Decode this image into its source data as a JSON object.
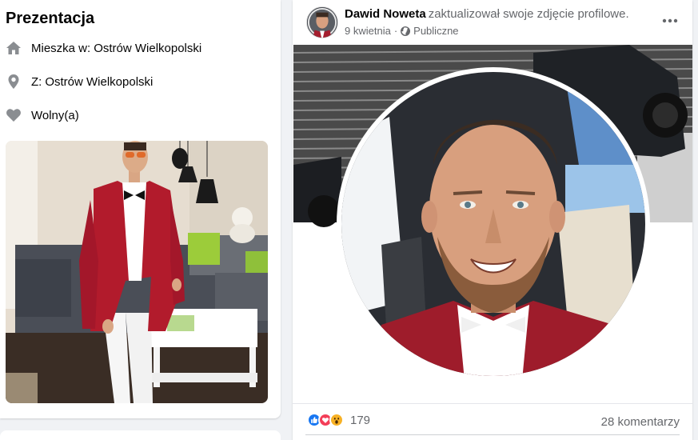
{
  "intro": {
    "title": "Prezentacja",
    "lives_label": "Mieszka w:",
    "lives_value": "Ostrów Wielkopolski",
    "from_label": "Z:",
    "from_value": "Ostrów Wielkopolski",
    "relationship": "Wolny(a)",
    "icons": {
      "lives": "home-icon",
      "from": "location-pin-icon",
      "relationship": "heart-icon"
    }
  },
  "post": {
    "author": "Dawid Noweta",
    "action": "zaktualizował swoje zdjęcie profilowe.",
    "date": "9 kwietnia",
    "separator": "·",
    "privacy": "Publiczne",
    "icons": {
      "privacy": "globe-icon",
      "more": "more-options-icon"
    },
    "reaction_count": "179",
    "reactions": [
      "like",
      "love",
      "wow"
    ],
    "comments": "28 komentarzy"
  },
  "colors": {
    "like": "#1877f2",
    "love": "#f33e58",
    "wow": "#f7b125",
    "secondary_text": "#65676b",
    "icon_gray": "#8a8d91"
  }
}
